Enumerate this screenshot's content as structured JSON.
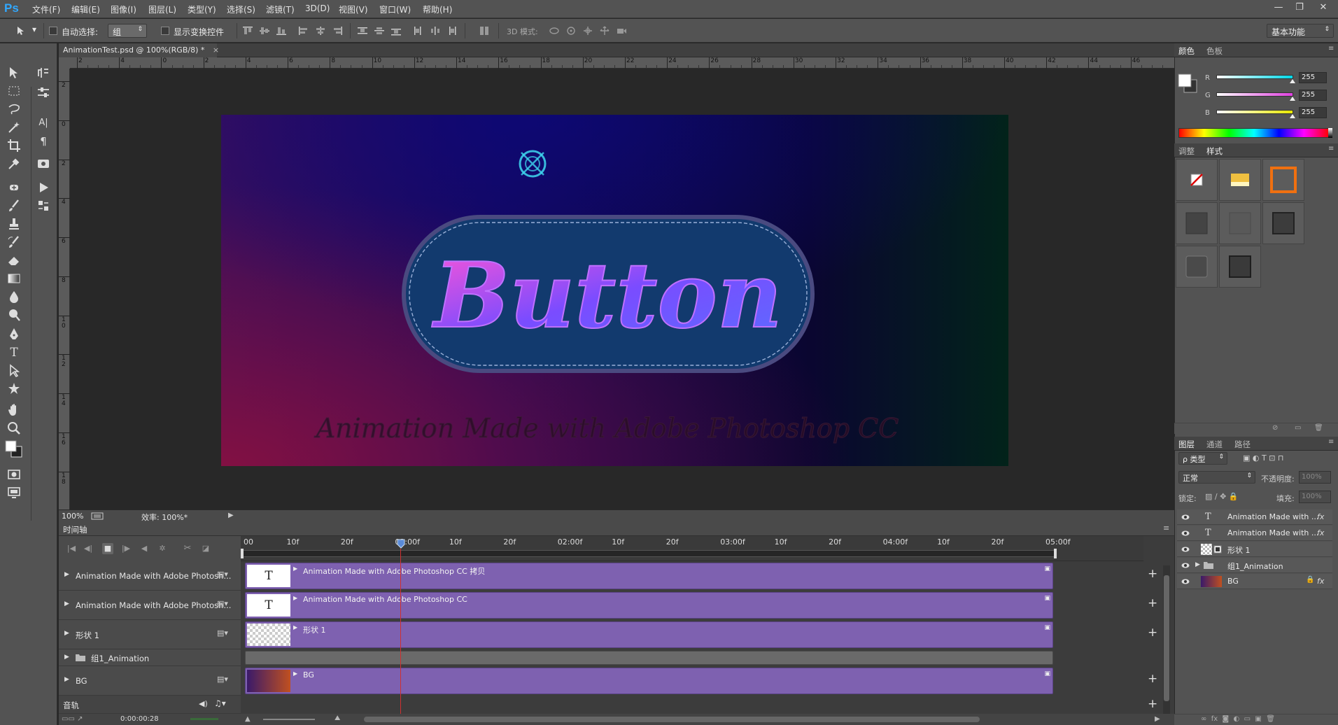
{
  "app": {
    "logo": "Ps",
    "menus": [
      "文件(F)",
      "编辑(E)",
      "图像(I)",
      "图层(L)",
      "类型(Y)",
      "选择(S)",
      "滤镜(T)",
      "3D(D)",
      "视图(V)",
      "窗口(W)",
      "帮助(H)"
    ],
    "window_controls": {
      "minimize": "—",
      "restore": "❐",
      "close": "✕"
    }
  },
  "options_bar": {
    "auto_select_label": "自动选择:",
    "auto_select_value": "组",
    "show_transform_label": "显示变换控件",
    "mode_3d_label": "3D 模式:",
    "workspace": "基本功能"
  },
  "document": {
    "tab_title": "AnimationTest.psd @ 100%(RGB/8) *",
    "tab_close": "×",
    "ruler_h": [
      "2",
      "4",
      "0",
      "2",
      "4",
      "6",
      "8",
      "10",
      "12",
      "14",
      "16",
      "18",
      "20",
      "22",
      "24",
      "26",
      "28",
      "30",
      "32",
      "34",
      "36",
      "38",
      "40",
      "42",
      "44",
      "46"
    ],
    "ruler_v": [
      "2",
      "0",
      "2",
      "4",
      "6",
      "8",
      "1 0",
      "1 2",
      "1 4",
      "1 6",
      "1 8"
    ],
    "canvas_button_text": "Button",
    "canvas_watermark": "Animation Made with Adobe Photoshop CC",
    "zoom": "100%",
    "efficiency": "效率: 100%*"
  },
  "timeline": {
    "title": "时间轴",
    "time_marks": [
      "00",
      "10f",
      "20f",
      "01:00f",
      "10f",
      "20f",
      "02:00f",
      "10f",
      "20f",
      "03:00f",
      "10f",
      "20f",
      "04:00f",
      "10f",
      "20f",
      "05:00f"
    ],
    "layers": [
      {
        "name": "Animation Made with Adobe Photosh...",
        "clip": "Animation Made with Adobe Photoshop CC 拷贝",
        "thumb": "T"
      },
      {
        "name": "Animation Made with Adobe Photosh...",
        "clip": "Animation Made with Adobe Photoshop CC",
        "thumb": "T"
      },
      {
        "name": "形状 1",
        "clip": "形状 1",
        "thumb": ""
      },
      {
        "name": "组1_Animation",
        "clip": "",
        "thumb": ""
      },
      {
        "name": "BG",
        "clip": "BG",
        "thumb": ""
      }
    ],
    "audio_label": "音轨",
    "current_time": "0:00:00:28",
    "playhead_fraction": 0.195
  },
  "color_panel": {
    "tabs": [
      "颜色",
      "色板"
    ],
    "channels": [
      {
        "label": "R",
        "value": "255",
        "color": "#00d8e8"
      },
      {
        "label": "G",
        "value": "255",
        "color": "#e040e0"
      },
      {
        "label": "B",
        "value": "255",
        "color": "#e8e800"
      }
    ]
  },
  "styles_panel": {
    "tabs": [
      "调整",
      "样式"
    ]
  },
  "layers_panel": {
    "tabs": [
      "图层",
      "通道",
      "路径"
    ],
    "filter_label": "ρ 类型",
    "blend_mode": "正常",
    "opacity_label": "不透明度:",
    "opacity_value": "100%",
    "lock_label": "锁定:",
    "fill_label": "填充:",
    "fill_value": "100%",
    "layers": [
      {
        "name": "Animation Made with ...",
        "kind": "T",
        "fx": "fx"
      },
      {
        "name": "Animation Made with ...",
        "kind": "T",
        "fx": "fx"
      },
      {
        "name": "形状 1",
        "kind": "",
        "fx": ""
      },
      {
        "name": "组1_Animation",
        "kind": "",
        "fx": ""
      },
      {
        "name": "BG",
        "kind": "",
        "fx": "fx"
      }
    ]
  },
  "colors": {
    "accent": "#31a8ff",
    "clip": "#7e61b0",
    "playhead": "#d03030"
  }
}
